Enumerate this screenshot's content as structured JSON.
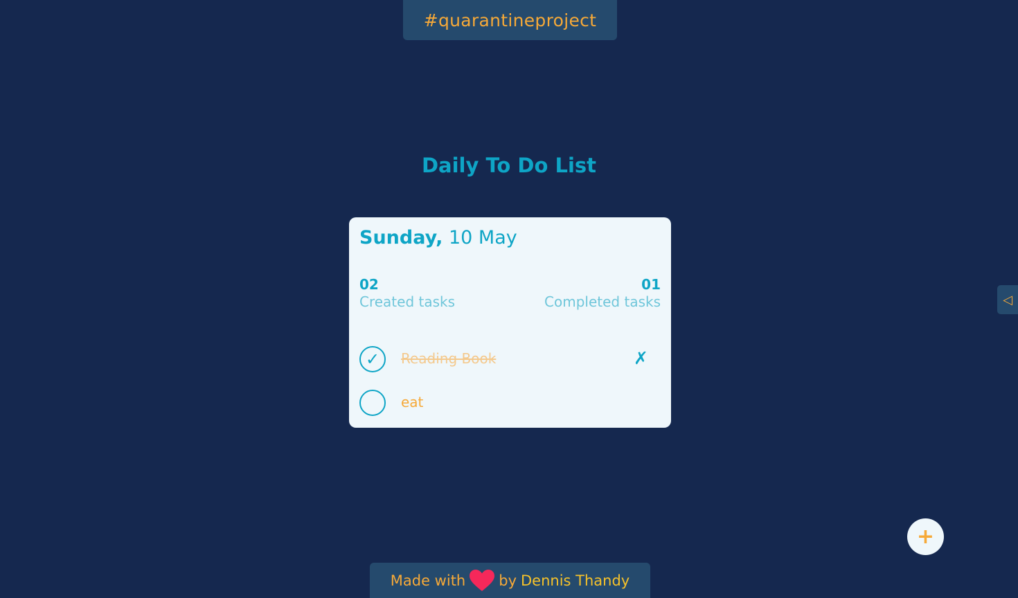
{
  "header": {
    "tag": "#quarantineproject"
  },
  "page": {
    "title": "Daily To Do List"
  },
  "card": {
    "day": "Sunday,",
    "date": "10 May",
    "stats": {
      "created_count": "02",
      "created_label": "Created tasks",
      "completed_count": "01",
      "completed_label": "Completed tasks"
    },
    "tasks": [
      {
        "name": "Reading Book",
        "done": true,
        "check_glyph": "✓",
        "remove_glyph": "✗"
      },
      {
        "name": "eat",
        "done": false,
        "check_glyph": ""
      }
    ]
  },
  "side_toggle": {
    "glyph": "◁"
  },
  "add_button": {
    "glyph": "+"
  },
  "footer": {
    "made_with": "Made with",
    "by": "by",
    "author": "Dennis Thandy",
    "heart_color": "#f5285a"
  },
  "colors": {
    "background": "#15284f",
    "accent": "#0ea5c6",
    "orange": "#f6a938",
    "panel": "#254a6d",
    "card": "#eff7fb"
  }
}
